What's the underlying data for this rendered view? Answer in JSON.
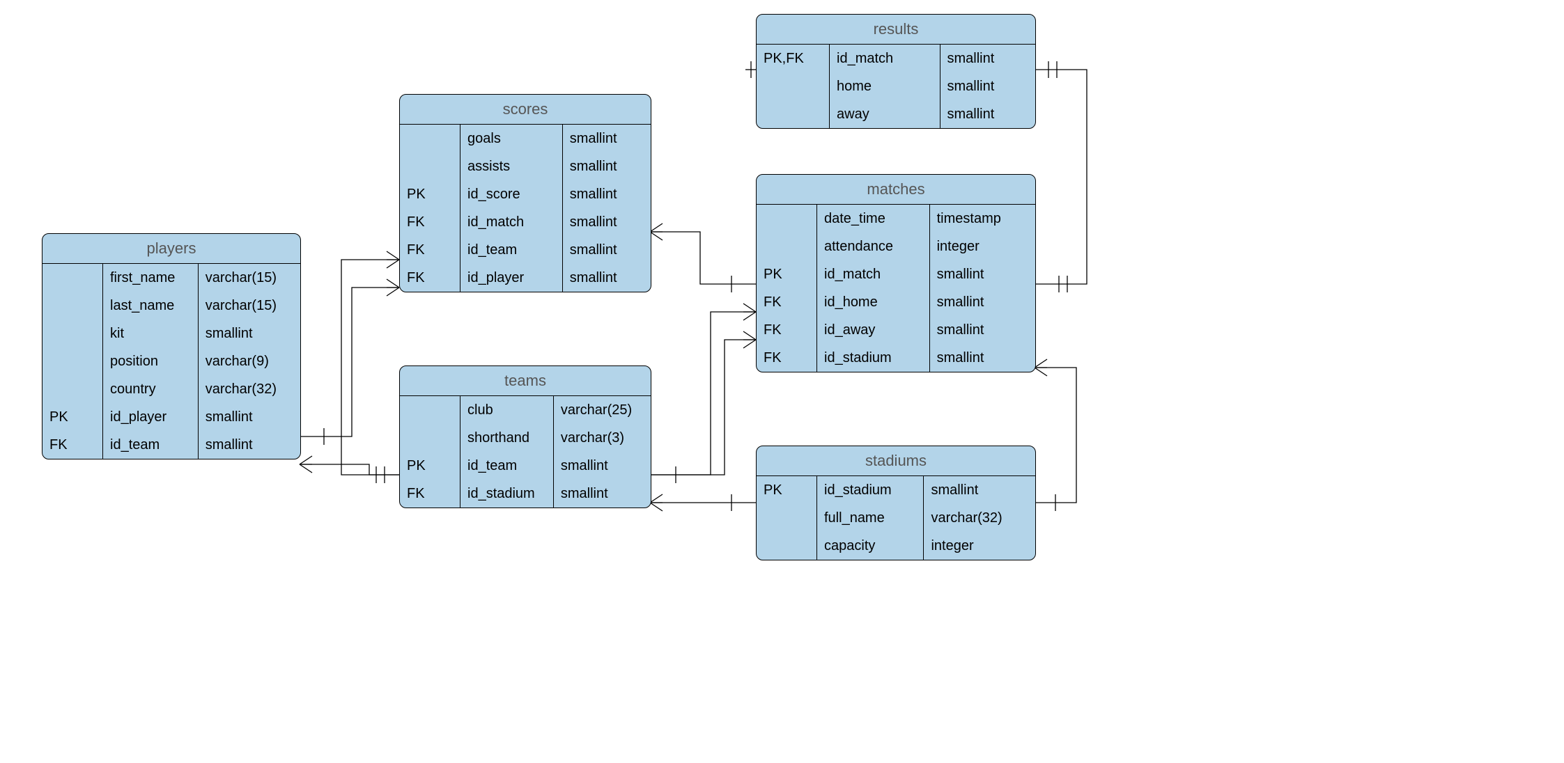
{
  "entities": {
    "players": {
      "title": "players",
      "rows": [
        {
          "key": "",
          "name": "first_name",
          "type": "varchar(15)"
        },
        {
          "key": "",
          "name": "last_name",
          "type": "varchar(15)"
        },
        {
          "key": "",
          "name": "kit",
          "type": "smallint"
        },
        {
          "key": "",
          "name": "position",
          "type": "varchar(9)"
        },
        {
          "key": "",
          "name": "country",
          "type": "varchar(32)"
        },
        {
          "key": "PK",
          "name": "id_player",
          "type": "smallint"
        },
        {
          "key": "FK",
          "name": "id_team",
          "type": "smallint"
        }
      ]
    },
    "scores": {
      "title": "scores",
      "rows": [
        {
          "key": "",
          "name": "goals",
          "type": "smallint"
        },
        {
          "key": "",
          "name": "assists",
          "type": "smallint"
        },
        {
          "key": "PK",
          "name": "id_score",
          "type": "smallint"
        },
        {
          "key": "FK",
          "name": "id_match",
          "type": "smallint"
        },
        {
          "key": "FK",
          "name": "id_team",
          "type": "smallint"
        },
        {
          "key": "FK",
          "name": "id_player",
          "type": "smallint"
        }
      ]
    },
    "teams": {
      "title": "teams",
      "rows": [
        {
          "key": "",
          "name": "club",
          "type": "varchar(25)"
        },
        {
          "key": "",
          "name": "shorthand",
          "type": "varchar(3)"
        },
        {
          "key": "PK",
          "name": "id_team",
          "type": "smallint"
        },
        {
          "key": "FK",
          "name": "id_stadium",
          "type": "smallint"
        }
      ]
    },
    "results": {
      "title": "results",
      "rows": [
        {
          "key": "PK,FK",
          "name": "id_match",
          "type": "smallint"
        },
        {
          "key": "",
          "name": "home",
          "type": "smallint"
        },
        {
          "key": "",
          "name": "away",
          "type": "smallint"
        }
      ]
    },
    "matches": {
      "title": "matches",
      "rows": [
        {
          "key": "",
          "name": "date_time",
          "type": "timestamp"
        },
        {
          "key": "",
          "name": "attendance",
          "type": "integer"
        },
        {
          "key": "PK",
          "name": "id_match",
          "type": "smallint"
        },
        {
          "key": "FK",
          "name": "id_home",
          "type": "smallint"
        },
        {
          "key": "FK",
          "name": "id_away",
          "type": "smallint"
        },
        {
          "key": "FK",
          "name": "id_stadium",
          "type": "smallint"
        }
      ]
    },
    "stadiums": {
      "title": "stadiums",
      "rows": [
        {
          "key": "PK",
          "name": "id_stadium",
          "type": "smallint"
        },
        {
          "key": "",
          "name": "full_name",
          "type": "varchar(32)"
        },
        {
          "key": "",
          "name": "capacity",
          "type": "integer"
        }
      ]
    }
  }
}
